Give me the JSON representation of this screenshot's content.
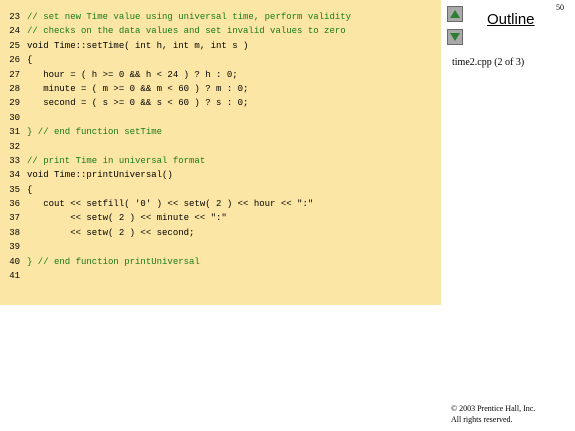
{
  "slide": {
    "page_number": "50",
    "outline_label": "Outline",
    "file_label": "time2.cpp (2 of 3)",
    "copyright_line1": "© 2003 Prentice Hall, Inc.",
    "copyright_line2": "All rights reserved."
  },
  "nav": {
    "up_icon": "up-triangle",
    "down_icon": "down-triangle"
  },
  "colors": {
    "panel_bg": "#fbe6a5",
    "comment": "#1a7a1a",
    "nav_button": "#a9a9a9"
  },
  "code": [
    {
      "num": "23",
      "text": "// set new Time value using universal time, perform validity",
      "comment": true
    },
    {
      "num": "24",
      "text": "// checks on the data values and set invalid values to zero",
      "comment": true
    },
    {
      "num": "25",
      "text": "void Time::setTime( int h, int m, int s )",
      "comment": false
    },
    {
      "num": "26",
      "text": "{",
      "comment": false
    },
    {
      "num": "27",
      "text": "   hour = ( h >= 0 && h < 24 ) ? h : 0;",
      "comment": false
    },
    {
      "num": "28",
      "text": "   minute = ( m >= 0 && m < 60 ) ? m : 0;",
      "comment": false
    },
    {
      "num": "29",
      "text": "   second = ( s >= 0 && s < 60 ) ? s : 0;",
      "comment": false
    },
    {
      "num": "30",
      "text": "",
      "comment": false
    },
    {
      "num": "31",
      "text": "} // end function setTime",
      "comment": true
    },
    {
      "num": "32",
      "text": "",
      "comment": false
    },
    {
      "num": "33",
      "text": "// print Time in universal format",
      "comment": true
    },
    {
      "num": "34",
      "text": "void Time::printUniversal()",
      "comment": false
    },
    {
      "num": "35",
      "text": "{",
      "comment": false
    },
    {
      "num": "36",
      "text": "   cout << setfill( '0' ) << setw( 2 ) << hour << \":\"",
      "comment": false
    },
    {
      "num": "37",
      "text": "        << setw( 2 ) << minute << \":\"",
      "comment": false
    },
    {
      "num": "38",
      "text": "        << setw( 2 ) << second;",
      "comment": false
    },
    {
      "num": "39",
      "text": "",
      "comment": false
    },
    {
      "num": "40",
      "text": "} // end function printUniversal",
      "comment": true
    },
    {
      "num": "41",
      "text": "",
      "comment": false
    }
  ]
}
